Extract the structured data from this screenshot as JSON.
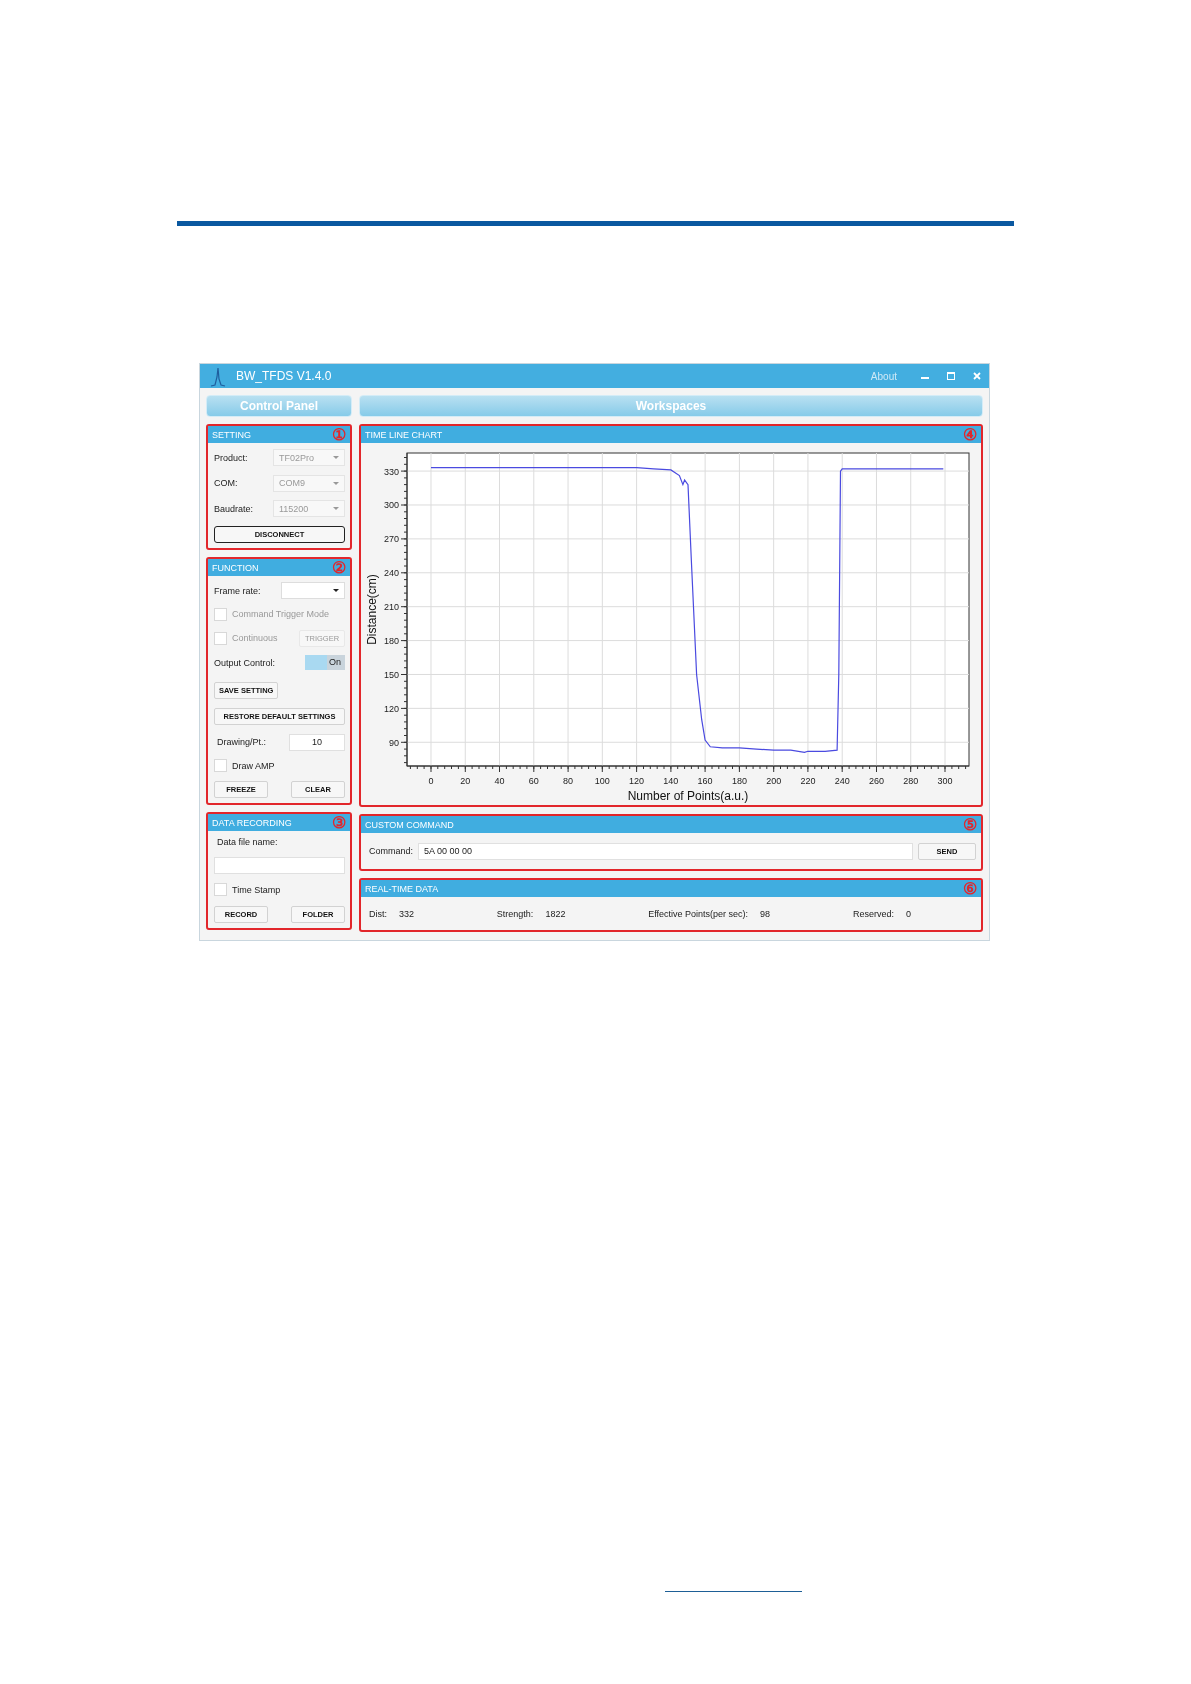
{
  "window": {
    "title": "BW_TFDS V1.4.0",
    "menu": "About"
  },
  "control_panel": {
    "title": "Control Panel",
    "setting": {
      "title": "SETTING",
      "marker": "①",
      "fields": [
        {
          "label": "Product:",
          "value": "TF02Pro",
          "disabled": true
        },
        {
          "label": "COM:",
          "value": "COM9",
          "disabled": true
        },
        {
          "label": "Baudrate:",
          "value": "115200",
          "disabled": true
        }
      ],
      "button": "DISCONNECT"
    },
    "function": {
      "title": "FUNCTION",
      "marker": "②",
      "frame_rate_label": "Frame rate:",
      "command_trigger": {
        "label": "Command Trigger Mode",
        "checked": false,
        "disabled": true
      },
      "continuous": {
        "label": "Continuous",
        "checked": false,
        "disabled": true
      },
      "trigger_button": "TRIGGER",
      "output_control": {
        "label": "Output Control:",
        "value": "On",
        "on": true
      },
      "save_button": "SAVE SETTING",
      "restore_button": "RESTORE DEFAULT SETTINGS",
      "drawing": {
        "label": "Drawing/Pt.:",
        "value": "10"
      },
      "draw_amp": {
        "label": "Draw AMP",
        "checked": false
      },
      "buttons": [
        "FREEZE",
        "CLEAR"
      ]
    },
    "data_recording": {
      "title": "DATA RECORDING",
      "marker": "③",
      "file_label": "Data file name:",
      "time_stamp": {
        "label": "Time Stamp",
        "checked": false
      },
      "buttons": [
        "RECORD",
        "FOLDER"
      ]
    }
  },
  "workspaces": {
    "title": "Workspaces",
    "time_line_chart": {
      "title": "TIME LINE CHART",
      "marker": "④",
      "chart_data": {
        "type": "line",
        "xlabel": "Number of Points(a.u.)",
        "ylabel": "Distance(cm)",
        "x": [
          0,
          10,
          20,
          30,
          40,
          50,
          60,
          70,
          80,
          90,
          100,
          110,
          120,
          130,
          140,
          145,
          147,
          148,
          150,
          152,
          155,
          158,
          160,
          163,
          170,
          180,
          190,
          200,
          210,
          218,
          220,
          230,
          237,
          238,
          239,
          240,
          250,
          260,
          270,
          280,
          290,
          299
        ],
        "grid": true,
        "series": [
          {
            "color": "#4a4ae0",
            "values": [
              333,
              333,
              333,
              333,
              333,
              333,
              333,
              333,
              333,
              333,
              333,
              333,
              333,
              332,
              331,
              326,
              318,
              322,
              318,
              250,
              150,
              110,
              92,
              86,
              85,
              85,
              84,
              83,
              83,
              81,
              82,
              82,
              83,
              150,
              330,
              332,
              332,
              332,
              332,
              332,
              332,
              332
            ]
          }
        ],
        "xlim": [
          -14,
          314
        ],
        "ylim": [
          69,
          346
        ],
        "xticks": [
          0,
          20,
          40,
          60,
          80,
          100,
          120,
          140,
          160,
          180,
          200,
          220,
          240,
          260,
          280,
          300
        ],
        "yticks": [
          90,
          120,
          150,
          180,
          210,
          240,
          270,
          300,
          330
        ]
      }
    },
    "custom_command": {
      "title": "CUSTOM COMMAND",
      "marker": "⑤",
      "label": "Command:",
      "value": "5A 00 00 00",
      "button": "SEND"
    },
    "real_time_data": {
      "title": "REAL-TIME DATA",
      "marker": "⑥",
      "items": [
        {
          "label": "Dist:",
          "value": "332"
        },
        {
          "label": "Strength:",
          "value": "1822"
        },
        {
          "label": "Effective Points(per sec):",
          "value": "98"
        },
        {
          "label": "Reserved:",
          "value": "0"
        }
      ]
    }
  }
}
